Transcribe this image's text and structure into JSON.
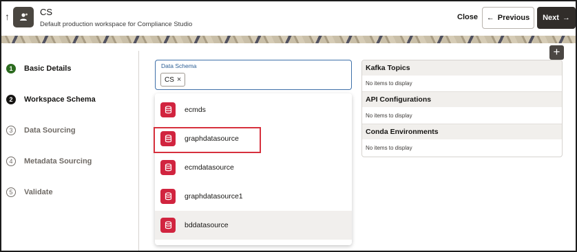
{
  "header": {
    "back_icon": "up-arrow-icon",
    "title": "CS",
    "subtitle": "Default production workspace for Compliance Studio",
    "close_label": "Close",
    "previous_label": "Previous",
    "next_label": "Next"
  },
  "steps": [
    {
      "number": "1",
      "label": "Basic Details",
      "state": "done"
    },
    {
      "number": "2",
      "label": "Workspace Schema",
      "state": "current"
    },
    {
      "number": "3",
      "label": "Data Sourcing",
      "state": "todo"
    },
    {
      "number": "4",
      "label": "Metadata Sourcing",
      "state": "todo"
    },
    {
      "number": "5",
      "label": "Validate",
      "state": "todo"
    }
  ],
  "schema_field": {
    "label": "Data Schema",
    "selected_chip": "CS",
    "chip_remove": "×"
  },
  "dropdown": {
    "options": [
      {
        "label": "ecmds"
      },
      {
        "label": "graphdatasource"
      },
      {
        "label": "ecmdatasource"
      },
      {
        "label": "graphdatasource1"
      },
      {
        "label": "bddatasource"
      }
    ]
  },
  "config_panel": {
    "sections": [
      {
        "title": "Kafka Topics",
        "empty_text": "No items to display"
      },
      {
        "title": "API Configurations",
        "empty_text": "No items to display"
      },
      {
        "title": "Conda Environments",
        "empty_text": "No items to display"
      }
    ]
  },
  "add_button": {
    "label": "+"
  },
  "colors": {
    "primary_dark": "#312d2a",
    "done_step": "#2c6b1f",
    "db_badge": "#d1243f",
    "highlight_border": "#d62f3c",
    "field_focus": "#3d6fa8"
  }
}
